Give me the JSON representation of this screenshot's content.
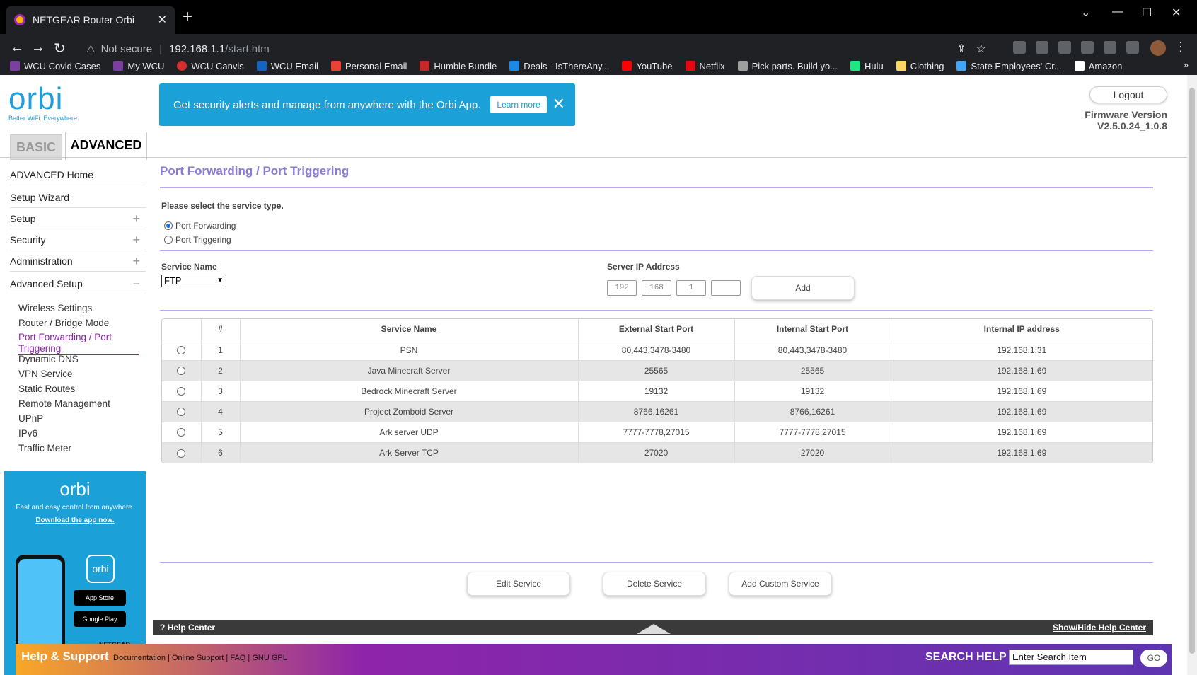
{
  "browser": {
    "tab_title": "NETGEAR Router Orbi",
    "security": "Not secure",
    "host": "192.168.1.1",
    "path": "/start.htm",
    "bookmarks": [
      "WCU Covid Cases",
      "My WCU",
      "WCU Canvis",
      "WCU Email",
      "Personal Email",
      "Humble Bundle",
      "Deals - IsThereAny...",
      "YouTube",
      "Netflix",
      "Pick parts. Build yo...",
      "Hulu",
      "Clothing",
      "State Employees' Cr...",
      "Amazon"
    ]
  },
  "header": {
    "logo": "orbi",
    "logo_tagline": "Better WiFi. Everywhere.",
    "promo_text": "Get security alerts and manage from anywhere with the Orbi App.",
    "promo_button": "Learn more",
    "logout": "Logout",
    "firmware_label": "Firmware Version",
    "firmware_value": "V2.5.0.24_1.0.8",
    "tab_basic": "BASIC",
    "tab_advanced": "ADVANCED"
  },
  "sidebar": {
    "nav": [
      "ADVANCED Home",
      "Setup Wizard",
      "Setup",
      "Security",
      "Administration",
      "Advanced Setup"
    ],
    "sub": [
      "Wireless Settings",
      "Router / Bridge Mode",
      "Port Forwarding / Port Triggering",
      "Dynamic DNS",
      "VPN Service",
      "Static Routes",
      "Remote Management",
      "UPnP",
      "IPv6",
      "Traffic Meter"
    ],
    "ad": {
      "logo": "orbi",
      "text": "Fast and easy control from anywhere.",
      "link": "Download the app now.",
      "app_icon": "orbi",
      "app_store": "App Store",
      "google_play": "Google Play",
      "brand": "NETGEAR"
    }
  },
  "main": {
    "title": "Port Forwarding / Port Triggering",
    "select_prompt": "Please select the service type.",
    "opt_forwarding": "Port Forwarding",
    "opt_triggering": "Port Triggering",
    "service_name_label": "Service Name",
    "service_name_value": "FTP",
    "server_ip_label": "Server IP Address",
    "ip": [
      "192",
      "168",
      "1",
      ""
    ],
    "add": "Add",
    "columns": [
      "#",
      "Service Name",
      "External Start Port",
      "Internal Start Port",
      "Internal IP address"
    ],
    "rows": [
      [
        "1",
        "PSN",
        "80,443,3478-3480",
        "80,443,3478-3480",
        "192.168.1.31"
      ],
      [
        "2",
        "Java Minecraft Server",
        "25565",
        "25565",
        "192.168.1.69"
      ],
      [
        "3",
        "Bedrock Minecraft Server",
        "19132",
        "19132",
        "192.168.1.69"
      ],
      [
        "4",
        "Project Zomboid Server",
        "8766,16261",
        "8766,16261",
        "192.168.1.69"
      ],
      [
        "5",
        "Ark server UDP",
        "7777-7778,27015",
        "7777-7778,27015",
        "192.168.1.69"
      ],
      [
        "6",
        "Ark Server TCP",
        "27020",
        "27020",
        "192.168.1.69"
      ]
    ],
    "edit": "Edit Service",
    "delete": "Delete Service",
    "add_custom": "Add Custom Service"
  },
  "help": {
    "left": "Help Center",
    "right": "Show/Hide Help Center"
  },
  "footer": {
    "help_support": "Help & Support",
    "links": [
      "Documentation",
      "Online Support",
      "FAQ",
      "GNU GPL"
    ],
    "search_label": "SEARCH HELP",
    "search_placeholder": "Enter Search Item",
    "go": "GO"
  }
}
